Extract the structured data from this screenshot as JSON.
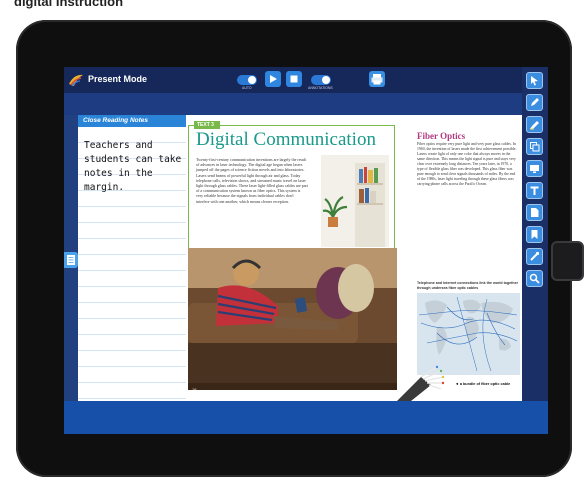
{
  "caption": "digital Instruction",
  "app": {
    "title": "Present Mode",
    "toggle_left_label": "AUTO",
    "toggle_right_label": "ANNOTATIONS"
  },
  "notes": {
    "header": "Close Reading Notes",
    "lines": [
      "Teachers and",
      "students can take",
      "notes in the margin."
    ]
  },
  "page": {
    "tag": "TEXT 3",
    "title": "Digital Communication",
    "body": "Twenty-first-century communication inventions are largely the result of advances in laser technology. The digital age began when lasers jumped off the pages of science fiction novels and into laboratories. Lasers send beams of powerful light through air and glass. Today telephone calls, television shows, and streamed music travel on laser light through glass cables. These laser light-filled glass cables are part of a communication system known as fiber optics. This system is very reliable because the signals from individual cables don't interfere with one another, which means clearer reception.",
    "page_number": "16"
  },
  "right_page": {
    "title": "Fiber Optics",
    "body": "Fiber optics require very pure light and very pure glass cables. In 1960, the invention of lasers made the first achievement possible. Lasers create light of only one color that always moves in the same direction. This means the light signal is pure and stays very clear over extremely long distances. Ten years later, in 1970, a type of flexible glass fiber was developed. This glass fiber was pure enough to send clear signals thousands of miles. By the end of the 1980s, laser light traveling through these glass fibers was carrying phone calls across the Pacific Ocean.",
    "map_caption": "Telephone and Internet connections link the world together through undersea fiber optic cables",
    "fiber_caption": "◄ a bundle of fiber optic cable"
  },
  "colors": {
    "accent": "#2f86e0",
    "title_teal": "#1a9a8a",
    "title_magenta": "#b13a83",
    "frame_green": "#79b84a"
  },
  "icons": [
    "app-logo-icon",
    "play-icon",
    "stop-icon",
    "print-icon",
    "pointer-icon",
    "pen-icon",
    "highlighter-icon",
    "copy-icon",
    "screen-icon",
    "text-icon",
    "page-icon",
    "bookmark-icon",
    "link-icon",
    "zoom-icon",
    "notes-tab-icon"
  ]
}
